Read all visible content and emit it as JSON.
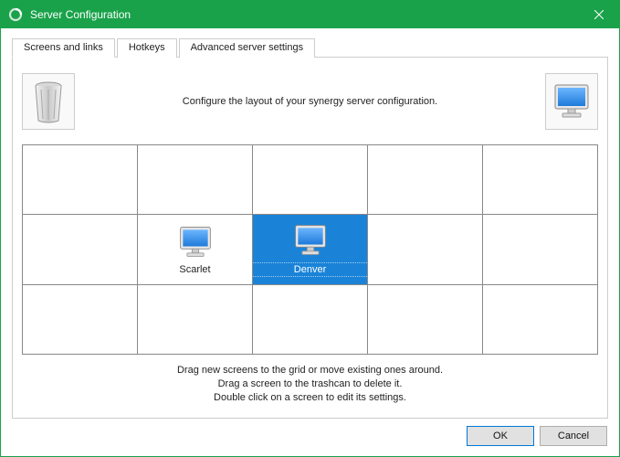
{
  "window": {
    "title": "Server Configuration"
  },
  "tabs": [
    {
      "label": "Screens and links",
      "active": true
    },
    {
      "label": "Hotkeys",
      "active": false
    },
    {
      "label": "Advanced server settings",
      "active": false
    }
  ],
  "instruction": "Configure the layout of your synergy server configuration.",
  "grid": {
    "rows": 3,
    "cols": 5,
    "cells": [
      {
        "row": 1,
        "col": 1,
        "label": "Scarlet",
        "selected": false
      },
      {
        "row": 1,
        "col": 2,
        "label": "Denver",
        "selected": true
      }
    ]
  },
  "hints": {
    "line1": "Drag new screens to the grid or move existing ones around.",
    "line2": "Drag a screen to the trashcan to delete it.",
    "line3": "Double click on a screen to edit its settings."
  },
  "buttons": {
    "ok": "OK",
    "cancel": "Cancel"
  },
  "icons": {
    "trashcan": "trashcan-icon",
    "monitor": "monitor-icon",
    "app": "ring-icon",
    "close": "close-icon"
  }
}
